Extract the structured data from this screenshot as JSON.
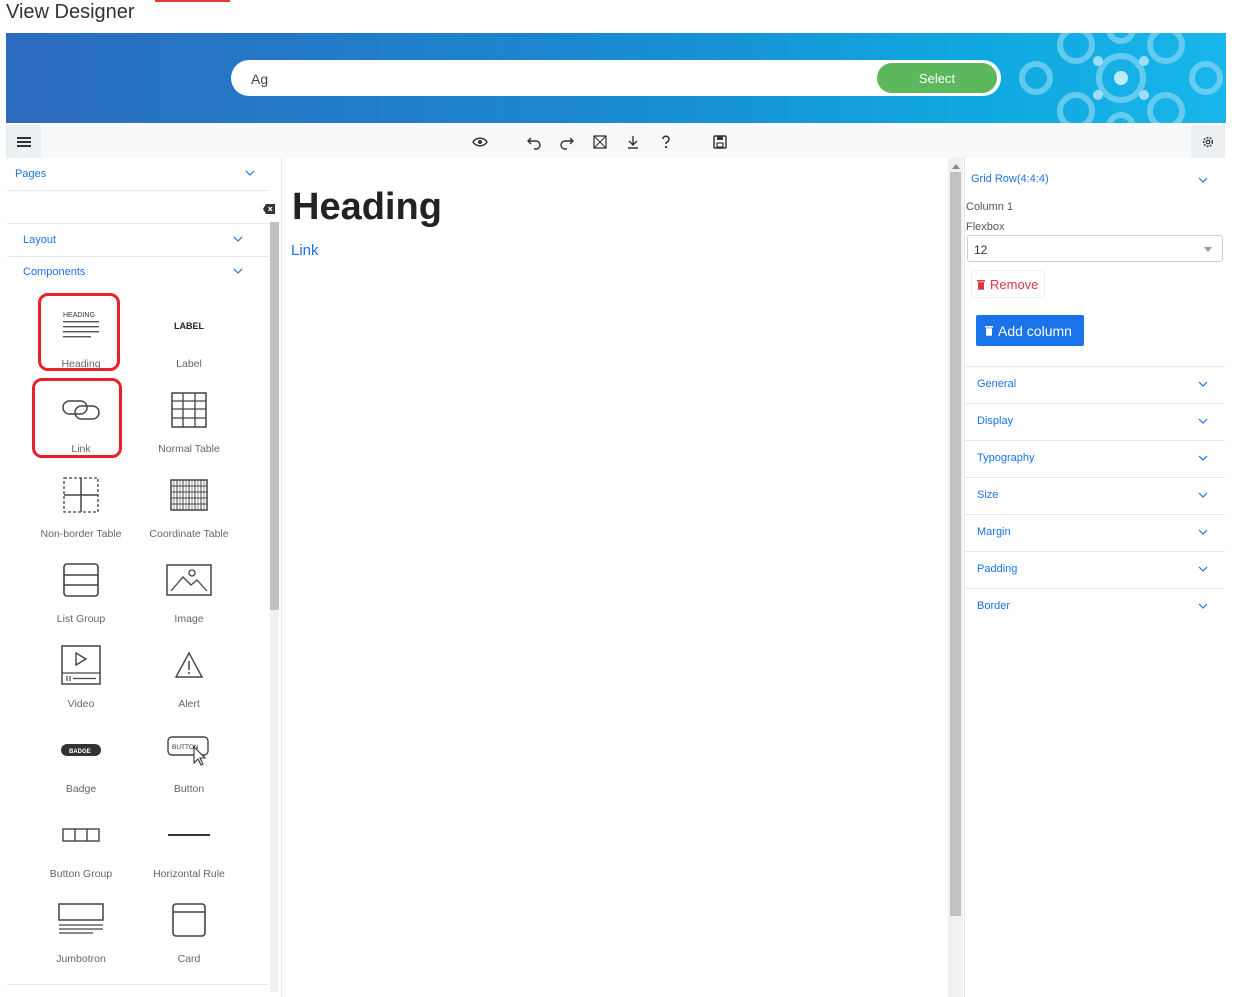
{
  "app": {
    "title": "View Designer"
  },
  "search": {
    "value": "Ag",
    "button_label": "Select"
  },
  "sidebar": {
    "pages_label": "Pages",
    "layout_label": "Layout",
    "components_label": "Components",
    "components": [
      {
        "label": "Heading",
        "icon": "heading-icon",
        "icon_text": "HEADING",
        "highlighted": true
      },
      {
        "label": "Label",
        "icon": "label-icon",
        "icon_text": "LABEL",
        "highlighted": false
      },
      {
        "label": "Link",
        "icon": "link-icon",
        "highlighted": true
      },
      {
        "label": "Normal Table",
        "icon": "table-icon",
        "highlighted": false
      },
      {
        "label": "Non-border Table",
        "icon": "non-border-table-icon",
        "highlighted": false
      },
      {
        "label": "Coordinate Table",
        "icon": "coordinate-table-icon",
        "highlighted": false
      },
      {
        "label": "List Group",
        "icon": "list-group-icon",
        "highlighted": false
      },
      {
        "label": "Image",
        "icon": "image-icon",
        "highlighted": false
      },
      {
        "label": "Video",
        "icon": "video-icon",
        "highlighted": false
      },
      {
        "label": "Alert",
        "icon": "alert-icon",
        "highlighted": false
      },
      {
        "label": "Badge",
        "icon": "badge-icon",
        "icon_text": "BADGE",
        "highlighted": false
      },
      {
        "label": "Button",
        "icon": "button-icon",
        "icon_text": "BUTTON",
        "highlighted": false
      },
      {
        "label": "Button Group",
        "icon": "button-group-icon",
        "highlighted": false
      },
      {
        "label": "Horizontal Rule",
        "icon": "horizontal-rule-icon",
        "highlighted": false
      },
      {
        "label": "Jumbotron",
        "icon": "jumbotron-icon",
        "highlighted": false
      },
      {
        "label": "Card",
        "icon": "card-icon",
        "highlighted": false
      }
    ]
  },
  "canvas": {
    "heading": "Heading",
    "link": "Link"
  },
  "properties": {
    "grid_row_label": "Grid Row(4:4:4)",
    "column_label": "Column 1",
    "flexbox_label": "Flexbox",
    "flexbox_value": "12",
    "remove_label": "Remove",
    "add_column_label": "Add column",
    "sections": [
      "General",
      "Display",
      "Typography",
      "Size",
      "Margin",
      "Padding",
      "Border"
    ]
  },
  "colors": {
    "accent": "#1a73e8",
    "select_button": "#5cb85c",
    "danger": "#dc3545",
    "highlight": "#e8202a"
  }
}
